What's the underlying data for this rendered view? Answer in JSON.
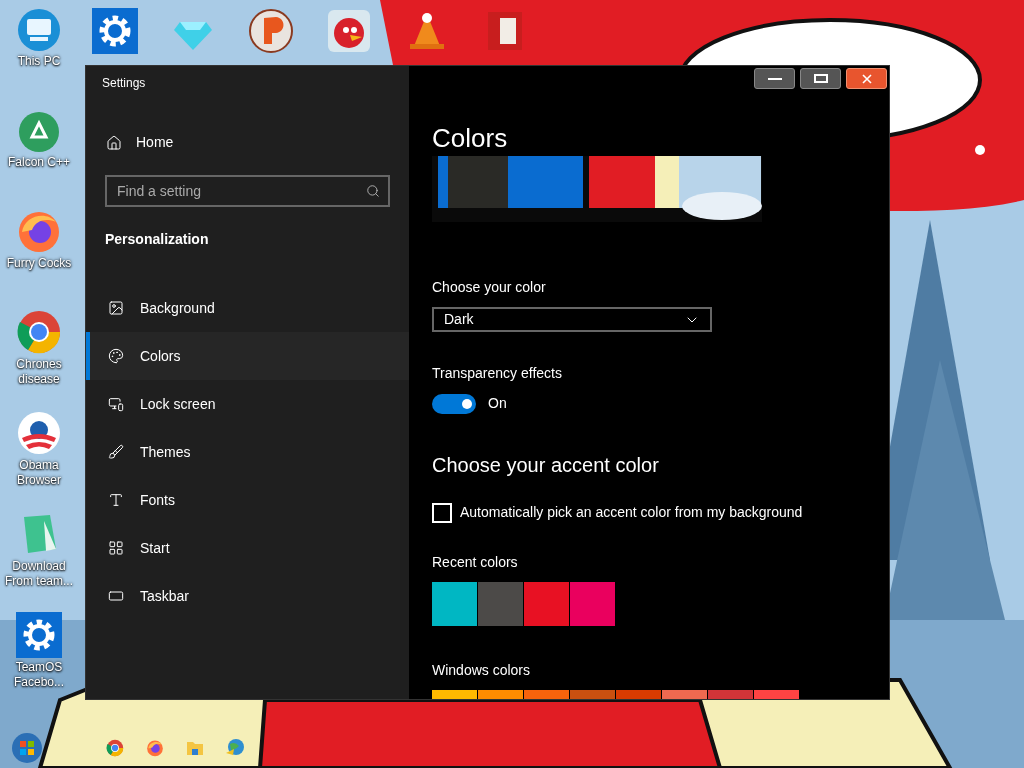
{
  "desktop_icons": [
    {
      "kind": "monitor",
      "label": "This PC"
    },
    {
      "kind": "recycle",
      "label": "Falcon C++"
    },
    {
      "kind": "fox",
      "label": "Furry Cocks"
    },
    {
      "kind": "ring",
      "label": "Chrones disease"
    },
    {
      "kind": "stripes",
      "label": "Obama Browser"
    },
    {
      "kind": "notepad",
      "label": "Download From team..."
    },
    {
      "kind": "gear",
      "label": "TeamOS Facebo..."
    }
  ],
  "top_icons": [
    {
      "kind": "gear"
    },
    {
      "kind": "gem"
    },
    {
      "kind": "disc"
    },
    {
      "kind": "bird"
    },
    {
      "kind": "cone"
    },
    {
      "kind": "card"
    }
  ],
  "window": {
    "title": "Settings"
  },
  "sidebar": {
    "home": "Home",
    "search": {
      "placeholder": "Find a setting"
    },
    "section": "Personalization",
    "items": [
      {
        "label": "Background",
        "selected": false
      },
      {
        "label": "Colors",
        "selected": true
      },
      {
        "label": "Lock screen",
        "selected": false
      },
      {
        "label": "Themes",
        "selected": false
      },
      {
        "label": "Fonts",
        "selected": false
      },
      {
        "label": "Start",
        "selected": false
      },
      {
        "label": "Taskbar",
        "selected": false
      }
    ]
  },
  "main": {
    "title": "Colors",
    "choose_color": {
      "label": "Choose your color",
      "value": "Dark"
    },
    "transparency": {
      "label": "Transparency effects",
      "on": true,
      "state_text": "On"
    },
    "accent_heading": "Choose your accent color",
    "auto_pick": {
      "label": "Automatically pick an accent color from my background",
      "checked": false
    },
    "recent_colors": {
      "label": "Recent colors",
      "swatches": [
        {
          "color": "#00b7c3"
        },
        {
          "color": "#4c4a48"
        },
        {
          "color": "#e81123"
        },
        {
          "color": "#ea005e"
        }
      ]
    },
    "windows_colors": {
      "label": "Windows colors",
      "swatches": [
        {
          "color": "#ffb900"
        },
        {
          "color": "#ff8c00"
        },
        {
          "color": "#f7630c"
        },
        {
          "color": "#ca5010"
        },
        {
          "color": "#da3b01"
        },
        {
          "color": "#ef6950"
        },
        {
          "color": "#d13438"
        },
        {
          "color": "#ff4343"
        }
      ]
    }
  },
  "taskbar": {
    "items": [
      {
        "kind": "start"
      },
      {
        "kind": "chrome"
      },
      {
        "kind": "firefox"
      },
      {
        "kind": "folder"
      },
      {
        "kind": "globe"
      }
    ]
  }
}
